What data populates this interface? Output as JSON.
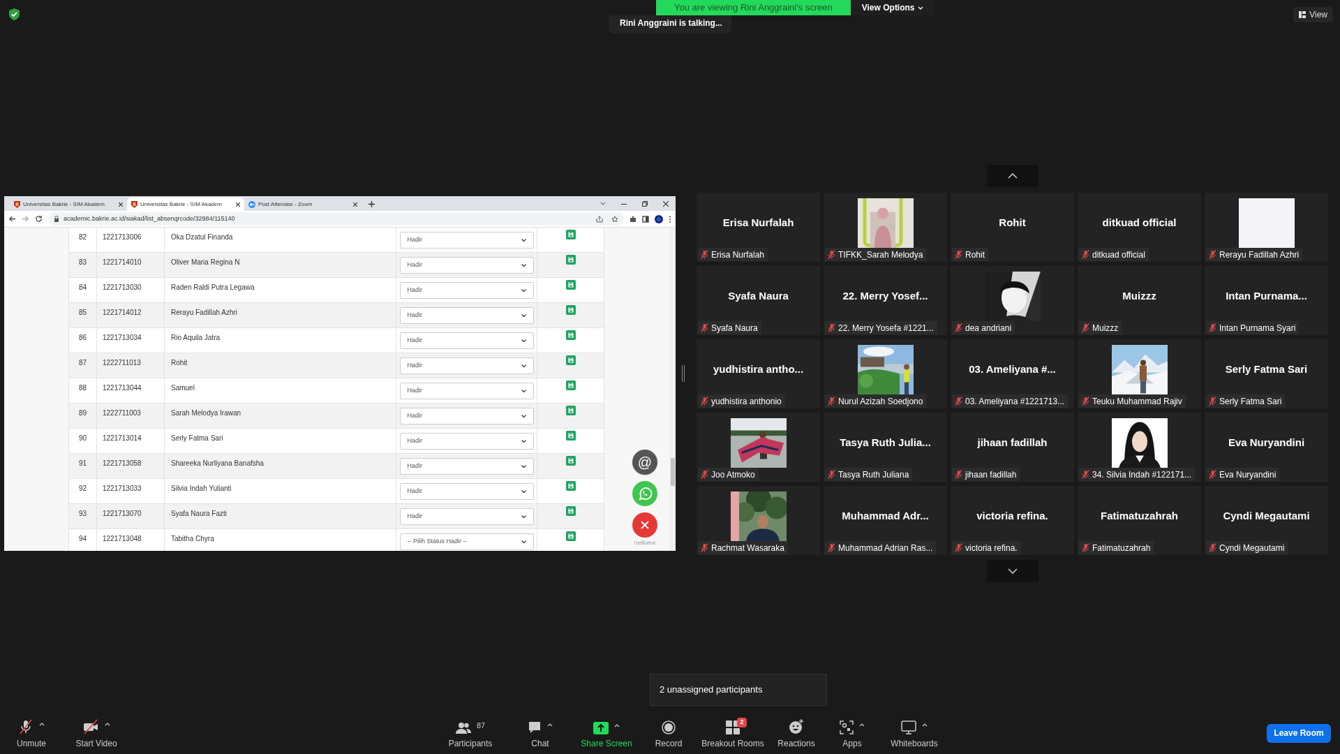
{
  "top_bar": {
    "banner": "You are viewing Rini Anggraini's screen",
    "view_options": "View Options",
    "talking": "Rini Anggraini is talking...",
    "view_button": "View"
  },
  "shared_screen": {
    "browser_tabs": [
      {
        "title": "Universitas Bakrie - SIM Akadem",
        "kind": "university",
        "selected": false
      },
      {
        "title": "Universitas Bakrie - SIM Akadem",
        "kind": "university",
        "selected": true
      },
      {
        "title": "Post Attendee - Zoom",
        "kind": "zoom",
        "selected": false
      }
    ],
    "url": "academic.bakrie.ac.id/siakad/list_absenqrcode/32984/115140",
    "rows": [
      {
        "no": "82",
        "nim": "1221713006",
        "name": "Oka Dzatul Finanda",
        "status": "Hadir"
      },
      {
        "no": "83",
        "nim": "1221714010",
        "name": "Oliver Maria Regina N",
        "status": "Hadir"
      },
      {
        "no": "84",
        "nim": "1221713030",
        "name": "Raden Raldi Putra Legawa",
        "status": "Hadir"
      },
      {
        "no": "85",
        "nim": "1221714012",
        "name": "Rerayu Fadillah Azhri",
        "status": "Hadir"
      },
      {
        "no": "86",
        "nim": "1221713034",
        "name": "Rio Aquila Jatra",
        "status": "Hadir"
      },
      {
        "no": "87",
        "nim": "1222711013",
        "name": "Rohit",
        "status": "Hadir"
      },
      {
        "no": "88",
        "nim": "1221713044",
        "name": "Samuel",
        "status": "Hadir"
      },
      {
        "no": "89",
        "nim": "1222711003",
        "name": "Sarah Melodya Irawan",
        "status": "Hadir"
      },
      {
        "no": "90",
        "nim": "1221713014",
        "name": "Serly Fatma Sari",
        "status": "Hadir"
      },
      {
        "no": "91",
        "nim": "1221713058",
        "name": "Shareeka Nurliyana Banafsha",
        "status": "Hadir"
      },
      {
        "no": "92",
        "nim": "1221713033",
        "name": "Silvia Indah Yulianti",
        "status": "Hadir"
      },
      {
        "no": "93",
        "nim": "1221713070",
        "name": "Syafa Naura Fazti",
        "status": "Hadir"
      },
      {
        "no": "94",
        "nim": "1221713048",
        "name": "Tabitha Chyra",
        "status": "-- Pilih Status Hadir --"
      }
    ],
    "email_button": "@",
    "getbutton_label": "GetButton"
  },
  "gallery": [
    {
      "kind": "name",
      "display_name": "Erisa Nurfalah",
      "label": "Erisa Nurfalah",
      "muted": true
    },
    {
      "kind": "picture",
      "label": "TIFKK_Sarah Melodya",
      "muted": true
    },
    {
      "kind": "name",
      "display_name": "Rohit",
      "label": "Rohit",
      "muted": true
    },
    {
      "kind": "name",
      "display_name": "ditkuad official",
      "label": "ditkuad official",
      "muted": true
    },
    {
      "kind": "blank",
      "label": "Rerayu Fadillah Azhri",
      "muted": true
    },
    {
      "kind": "name",
      "display_name": "Syafa Naura",
      "label": "Syafa Naura",
      "muted": true
    },
    {
      "kind": "name",
      "display_name": "22. Merry Yosef...",
      "label": "22. Merry Yosefa #1221...",
      "muted": true
    },
    {
      "kind": "picture",
      "label": "dea andriani",
      "muted": true
    },
    {
      "kind": "name",
      "display_name": "Muizzz",
      "label": "Muizzz",
      "muted": true
    },
    {
      "kind": "name",
      "display_name": "Intan Purnama...",
      "label": "Intan Purnama Syari",
      "muted": true
    },
    {
      "kind": "name",
      "display_name": "yudhistira antho...",
      "label": "yudhistira anthonio",
      "muted": true
    },
    {
      "kind": "picture",
      "label": "Nurul Azizah Soedjono",
      "muted": true
    },
    {
      "kind": "name",
      "display_name": "03. Ameliyana #...",
      "label": "03. Ameliyana #1221713...",
      "muted": true
    },
    {
      "kind": "picture",
      "label": "Teuku Muhammad Rajiv",
      "muted": true
    },
    {
      "kind": "name",
      "display_name": "Serly Fatma Sari",
      "label": "Serly Fatma Sari",
      "muted": true
    },
    {
      "kind": "picture",
      "label": "Joo Atmoko",
      "muted": true
    },
    {
      "kind": "name",
      "display_name": "Tasya Ruth Julia...",
      "label": "Tasya Ruth Juliana",
      "muted": true
    },
    {
      "kind": "name",
      "display_name": "jihaan fadillah",
      "label": "jihaan fadillah",
      "muted": true
    },
    {
      "kind": "picture",
      "label": "34. Silvia Indah #122171...",
      "muted": true
    },
    {
      "kind": "name",
      "display_name": "Eva Nuryandini",
      "label": "Eva Nuryandini",
      "muted": true
    },
    {
      "kind": "picture",
      "label": "Rachmat Wasaraka",
      "muted": true
    },
    {
      "kind": "name",
      "display_name": "Muhammad Adr...",
      "label": "Muhammad Adrian Ras...",
      "muted": true
    },
    {
      "kind": "name",
      "display_name": "victoria refina.",
      "label": "victoria refina.",
      "muted": true
    },
    {
      "kind": "name",
      "display_name": "Fatimatuzahrah",
      "label": "Fatimatuzahrah",
      "muted": true
    },
    {
      "kind": "name",
      "display_name": "Cyndi Megautami",
      "label": "Cyndi Megautami",
      "muted": true
    }
  ],
  "tooltip": "2 unassigned participants",
  "toolbar": [
    {
      "kind": "mic",
      "label": "Unmute",
      "caret": true
    },
    {
      "kind": "video",
      "label": "Start Video",
      "caret": true
    },
    {
      "kind": "participants",
      "label": "Participants",
      "count": "87",
      "caret": false
    },
    {
      "kind": "chat",
      "label": "Chat",
      "caret": true
    },
    {
      "kind": "share",
      "label": "Share Screen",
      "caret": true
    },
    {
      "kind": "record",
      "label": "Record",
      "caret": false
    },
    {
      "kind": "breakout",
      "label": "Breakout Rooms",
      "badge": "2",
      "caret": false
    },
    {
      "kind": "reactions",
      "label": "Reactions",
      "caret": false
    },
    {
      "kind": "apps",
      "label": "Apps",
      "caret": true
    },
    {
      "kind": "whiteboards",
      "label": "Whiteboards",
      "caret": true
    }
  ],
  "leave_button": "Leave Room"
}
